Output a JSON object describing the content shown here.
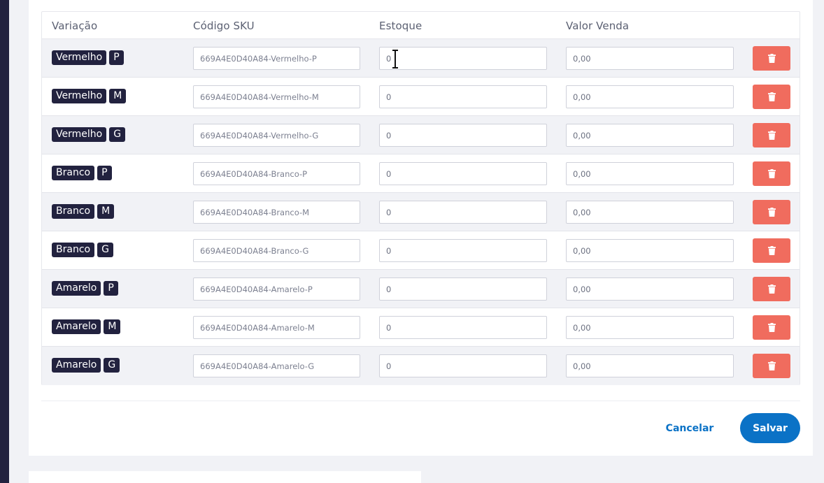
{
  "table": {
    "headers": [
      "Variação",
      "Código SKU",
      "Estoque",
      "Valor Venda"
    ],
    "rows": [
      {
        "color": "Vermelho",
        "size": "P",
        "sku": "669A4E0D40A84-Vermelho-P",
        "stock": "0",
        "price": "0,00"
      },
      {
        "color": "Vermelho",
        "size": "M",
        "sku": "669A4E0D40A84-Vermelho-M",
        "stock": "0",
        "price": "0,00"
      },
      {
        "color": "Vermelho",
        "size": "G",
        "sku": "669A4E0D40A84-Vermelho-G",
        "stock": "0",
        "price": "0,00"
      },
      {
        "color": "Branco",
        "size": "P",
        "sku": "669A4E0D40A84-Branco-P",
        "stock": "0",
        "price": "0,00"
      },
      {
        "color": "Branco",
        "size": "M",
        "sku": "669A4E0D40A84-Branco-M",
        "stock": "0",
        "price": "0,00"
      },
      {
        "color": "Branco",
        "size": "G",
        "sku": "669A4E0D40A84-Branco-G",
        "stock": "0",
        "price": "0,00"
      },
      {
        "color": "Amarelo",
        "size": "P",
        "sku": "669A4E0D40A84-Amarelo-P",
        "stock": "0",
        "price": "0,00"
      },
      {
        "color": "Amarelo",
        "size": "M",
        "sku": "669A4E0D40A84-Amarelo-M",
        "stock": "0",
        "price": "0,00"
      },
      {
        "color": "Amarelo",
        "size": "G",
        "sku": "669A4E0D40A84-Amarelo-G",
        "stock": "0",
        "price": "0,00"
      }
    ],
    "delete_icon": "trash-icon"
  },
  "actions": {
    "cancel_label": "Cancelar",
    "save_label": "Salvar"
  },
  "colors": {
    "sidebar": "#22223f",
    "badge": "#22223f",
    "delete": "#f06c5e",
    "primary": "#0b72c6",
    "page_bg": "#f1f2f6"
  }
}
